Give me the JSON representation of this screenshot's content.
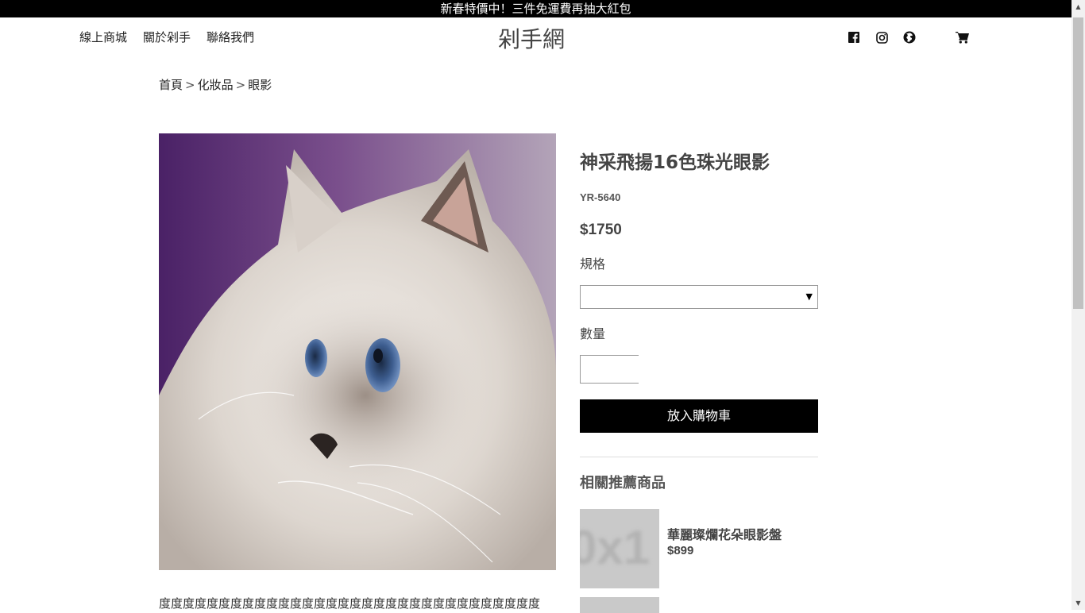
{
  "banner": {
    "text": "新春特價中！三件免運費再抽大紅包"
  },
  "nav": {
    "links": [
      "線上商城",
      "關於剁手",
      "聯絡我們"
    ],
    "logo": "剁手網",
    "icons": [
      "facebook-icon",
      "instagram-icon",
      "globe-icon",
      "cart-icon"
    ]
  },
  "breadcrumb": {
    "items": [
      "首頁",
      "化妝品",
      "眼影"
    ],
    "separator": ">"
  },
  "product": {
    "title": "神采飛揚16色珠光眼影",
    "sku": "YR-5640",
    "price": "$1750",
    "spec_label": "規格",
    "spec_value": "",
    "qty_label": "數量",
    "qty_value": "",
    "cart_button": "放入購物車",
    "description": "度度度度度度度度度度度度度度度度度度度度度度度度度度度度度度度度"
  },
  "related": {
    "title": "相關推薦商品",
    "items": [
      {
        "name": "華麗璨爛花朵眼影盤",
        "price": "$899",
        "placeholder": "0x1"
      }
    ]
  }
}
